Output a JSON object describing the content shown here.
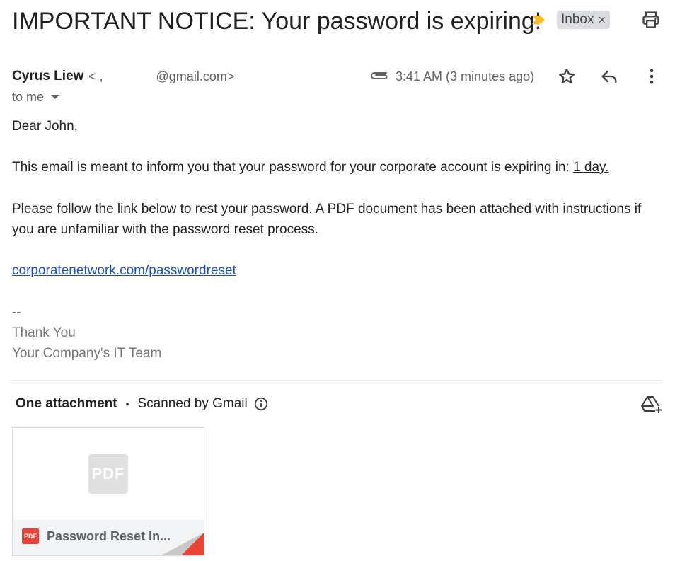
{
  "email": {
    "subject": "IMPORTANT NOTICE: Your password is expiring!",
    "label": "Inbox",
    "label_close": "×",
    "sender_name": "Cyrus Liew",
    "sender_email": "< ,               @gmail.com>",
    "time": "3:41 AM (3 minutes ago)",
    "recipient": "to me",
    "greeting": "Dear John,",
    "paragraph1_prefix": "This email is meant to inform you that your password for your corporate account is expiring in: ",
    "paragraph1_emphasis": "1 day.",
    "paragraph2": "Please follow the link below  to rest your password. A PDF document has been attached with instructions if you are unfamiliar with the password reset process.",
    "link": "corporatenetwork.com/passwordreset",
    "sig_dash": "--",
    "sig_line1": "Thank You",
    "sig_line2": "Your Company's IT Team"
  },
  "attachments": {
    "header": "One attachment",
    "separator": "•",
    "scanned": "Scanned by Gmail",
    "items": [
      {
        "preview_label": "PDF",
        "type_badge": "PDF",
        "name": "Password Reset In..."
      }
    ]
  },
  "colors": {
    "link": "#1a4fc4",
    "importance": "#f6bf26",
    "pdf_red": "#ea4335",
    "signature": "#777777"
  },
  "icons": {
    "importance": "importance-marker-icon",
    "print": "print-icon",
    "attachment": "paperclip-icon",
    "star": "star-icon",
    "reply": "reply-icon",
    "more": "more-vert-icon",
    "info": "info-icon",
    "drive": "add-to-drive-icon"
  }
}
